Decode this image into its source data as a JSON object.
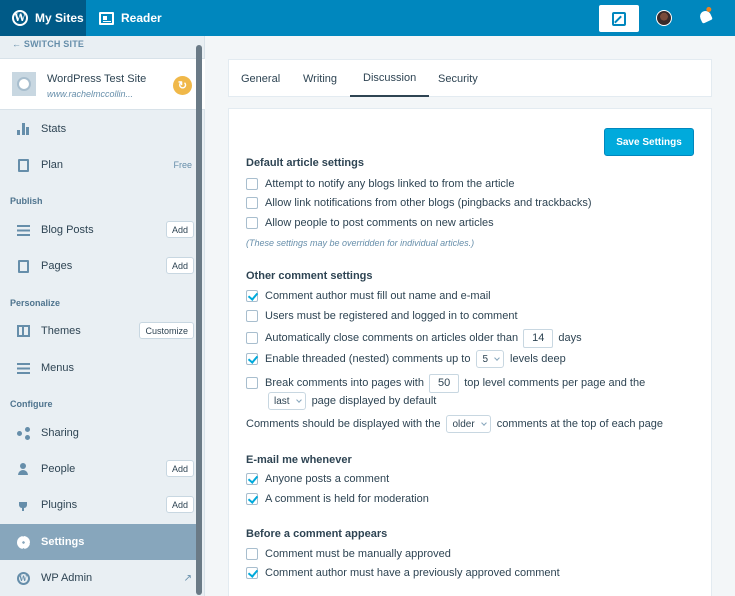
{
  "topbar": {
    "my_sites": "My Sites",
    "reader": "Reader"
  },
  "sidebar": {
    "switch_site": "SWITCH SITE",
    "site": {
      "title": "WordPress Test Site",
      "url": "www.rachelmccollin..."
    },
    "items": [
      {
        "label": "Stats"
      },
      {
        "label": "Plan",
        "badge": "Free"
      },
      {
        "section": "Publish"
      },
      {
        "label": "Blog Posts",
        "button": "Add"
      },
      {
        "label": "Pages",
        "button": "Add"
      },
      {
        "section": "Personalize"
      },
      {
        "label": "Themes",
        "button": "Customize"
      },
      {
        "label": "Menus"
      },
      {
        "section": "Configure"
      },
      {
        "label": "Sharing"
      },
      {
        "label": "People",
        "button": "Add"
      },
      {
        "label": "Plugins",
        "button": "Add"
      },
      {
        "label": "Settings"
      },
      {
        "label": "WP Admin"
      }
    ]
  },
  "tabs": [
    "General",
    "Writing",
    "Discussion",
    "Security"
  ],
  "active_tab": "Discussion",
  "save_button": "Save Settings",
  "default_article": {
    "title": "Default article settings",
    "options": [
      {
        "label": "Attempt to notify any blogs linked to from the article",
        "checked": false
      },
      {
        "label": "Allow link notifications from other blogs (pingbacks and trackbacks)",
        "checked": false
      },
      {
        "label": "Allow people to post comments on new articles",
        "checked": false
      }
    ],
    "note": "(These settings may be overridden for individual articles.)"
  },
  "other_comment": {
    "title": "Other comment settings",
    "name_email": "Comment author must fill out name and e-mail",
    "registered": "Users must be registered and logged in to comment",
    "close_before": "Automatically close comments on articles older than",
    "close_days": "14",
    "close_after": "days",
    "threaded_before": "Enable threaded (nested) comments up to",
    "threaded_levels": "5",
    "threaded_after": "levels deep",
    "break_before": "Break comments into pages with",
    "break_count": "50",
    "break_after": "top level comments per page and the",
    "page_select": "last",
    "page_after": "page displayed by default",
    "order_before": "Comments should be displayed with the",
    "order_select": "older",
    "order_after": "comments at the top of each page"
  },
  "email": {
    "title": "E-mail me whenever",
    "anyone_posts": "Anyone posts a comment",
    "held": "A comment is held for moderation"
  },
  "before": {
    "title": "Before a comment appears",
    "manual": "Comment must be manually approved",
    "previous": "Comment author must have a previously approved comment"
  },
  "colors": {
    "topbar": "#0087be",
    "accent": "#00aadc",
    "sidebar_selected": "#87a6bc"
  }
}
